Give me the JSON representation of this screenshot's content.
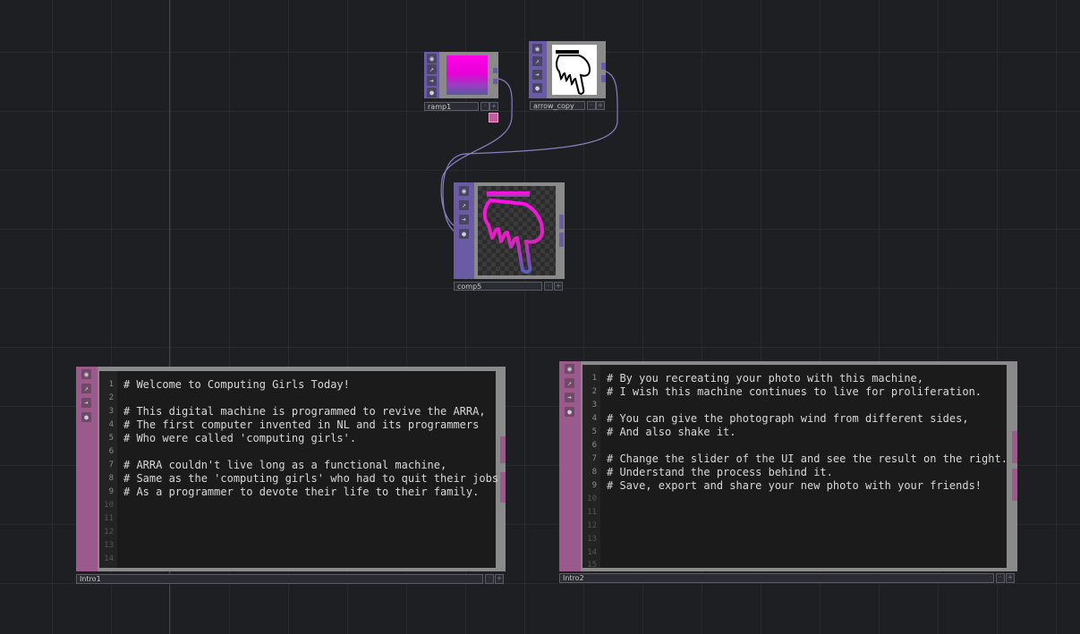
{
  "nodes": {
    "ramp1": {
      "name": "ramp1"
    },
    "arrow_copy": {
      "name": "arrow_copy"
    },
    "comp5": {
      "name": "comp5"
    }
  },
  "intro1": {
    "name": "Intro1",
    "line_numbers": [
      "1",
      "2",
      "3",
      "4",
      "5",
      "6",
      "7",
      "8",
      "9",
      "10",
      "11",
      "12",
      "13",
      "14"
    ],
    "lines": [
      "# Welcome to Computing Girls Today!",
      "",
      "# This digital machine is programmed to revive the ARRA,",
      "# The first computer invented in NL and its programmers",
      "# Who were called 'computing girls'.",
      "",
      "# ARRA couldn't live long as a functional machine,",
      "# Same as the 'computing girls' who had to quit their jobs",
      "# As a programmer to devote their life to their family."
    ]
  },
  "intro2": {
    "name": "Intro2",
    "line_numbers": [
      "1",
      "2",
      "3",
      "4",
      "5",
      "6",
      "7",
      "8",
      "9",
      "10",
      "11",
      "12",
      "13",
      "14",
      "15"
    ],
    "lines": [
      "# By you recreating your photo with this machine,",
      "# I wish this machine continues to live for proliferation.",
      "",
      "# You can give the photograph wind from different sides,",
      "# And also shake it.",
      "",
      "# Change the slider of the UI and see the result on the right.",
      "# Understand the process behind it.",
      "# Save, export and share your new photo with your friends!"
    ]
  },
  "colors": {
    "background": "#1d1f23",
    "top_node_side": "#6b5aa5",
    "dat_side": "#9a5a8c",
    "wire": "#8a7fc4",
    "ramp_top": "#ff00e6",
    "ramp_bottom": "#5a5aa0"
  },
  "icons": [
    "viewer-icon",
    "bypass-icon",
    "arrow-icon",
    "lock-icon",
    "plus-icon",
    "hand-cursor-icon"
  ]
}
